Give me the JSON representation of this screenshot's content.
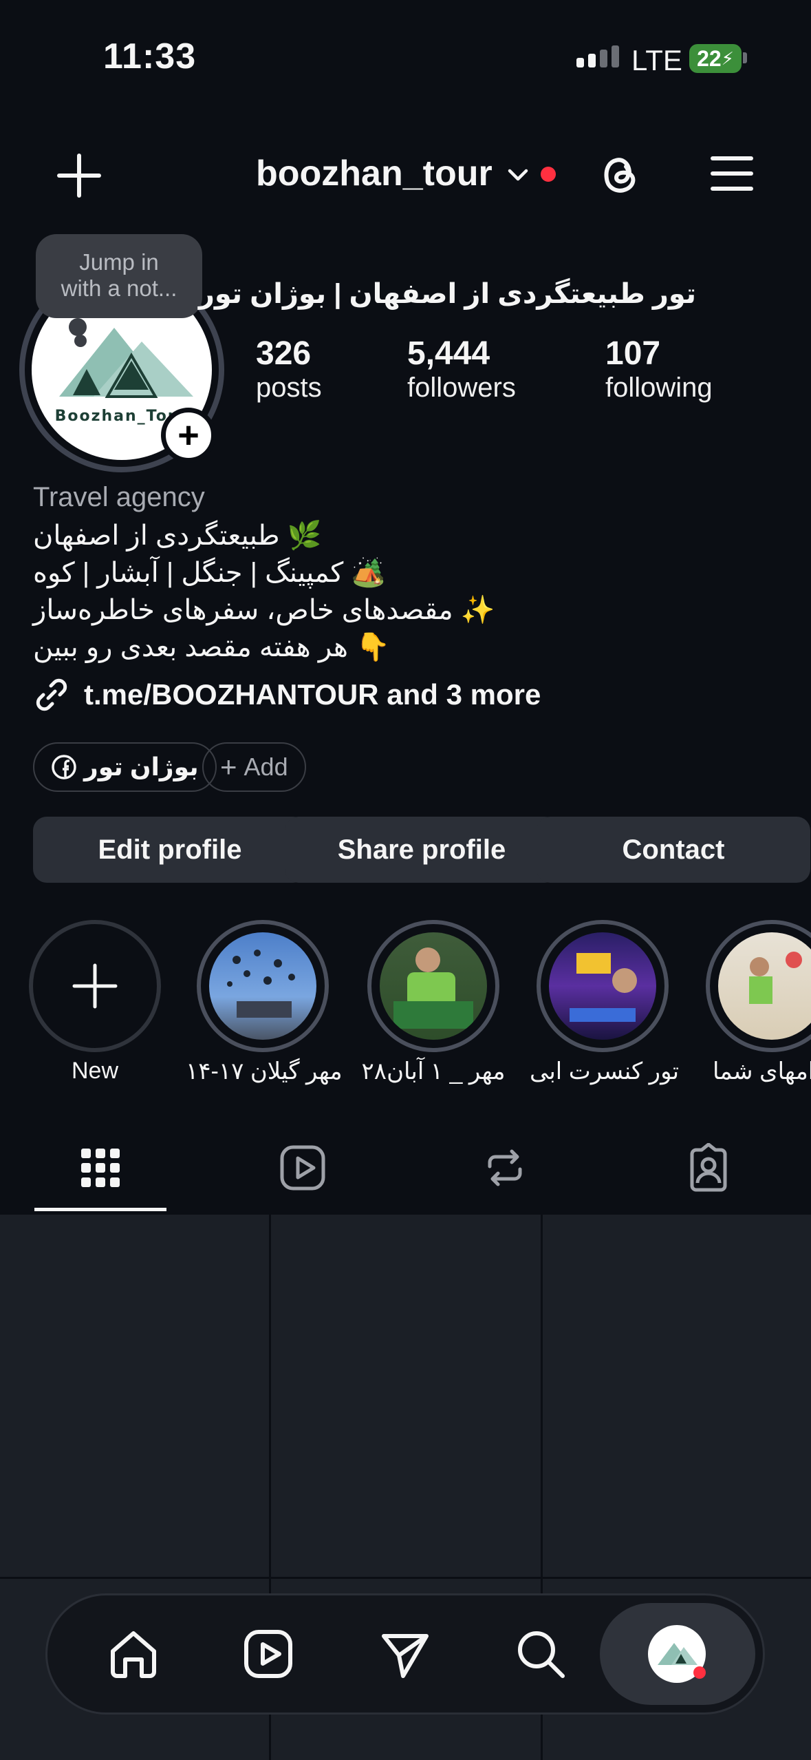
{
  "status_bar": {
    "time": "11:33",
    "network": "LTE",
    "battery": "22"
  },
  "header": {
    "username": "boozhan_tour",
    "new_post_icon": "plus-icon",
    "threads_icon": "threads-icon",
    "menu_icon": "hamburger-menu-icon"
  },
  "profile": {
    "display_name": "تور طبیعتگردی از اصفهان | بوژان تور",
    "avatar_text": "Boozhan_Tour",
    "tooltip": {
      "line1": "Jump in",
      "line2": "with a not..."
    },
    "stats": [
      {
        "value": "326",
        "label": "posts"
      },
      {
        "value": "5,444",
        "label": "followers"
      },
      {
        "value": "107",
        "label": "following"
      }
    ],
    "category": "Travel agency",
    "bio": [
      {
        "text": "طبیعتگردی از اصفهان",
        "emoji": "🌿"
      },
      {
        "text": "کمپینگ | جنگل | آبشار | کوه",
        "emoji": "🏕️"
      },
      {
        "text": "مقصدهای خاص، سفرهای خاطره‌ساز",
        "emoji": "✨"
      },
      {
        "text": "هر هفته مقصد بعدی رو ببین",
        "emoji": "👇"
      }
    ],
    "link": "t.me/BOOZHANTOUR and 3 more",
    "chips": {
      "facebook": "بوژان تور",
      "add": "Add"
    }
  },
  "buttons": {
    "edit": "Edit profile",
    "share": "Share profile",
    "contact": "Contact"
  },
  "highlights": [
    {
      "label": "New"
    },
    {
      "label": "۱۴-۱۷ مهر گیلان"
    },
    {
      "label": "۲۸مهر _ ۱ آبان"
    },
    {
      "label": "تور کنسرت ابی"
    },
    {
      "label": "امهای شما"
    }
  ],
  "tabs": [
    "grid-icon",
    "reels-icon",
    "reposts-icon",
    "tagged-icon"
  ],
  "bottom_nav": [
    "home-icon",
    "reels-icon",
    "send-icon",
    "search-icon",
    "profile-avatar"
  ],
  "colors": {
    "background": "#0b0e14",
    "button": "#2b2f37",
    "notification": "#ff3040",
    "battery": "#3c8f3a"
  }
}
